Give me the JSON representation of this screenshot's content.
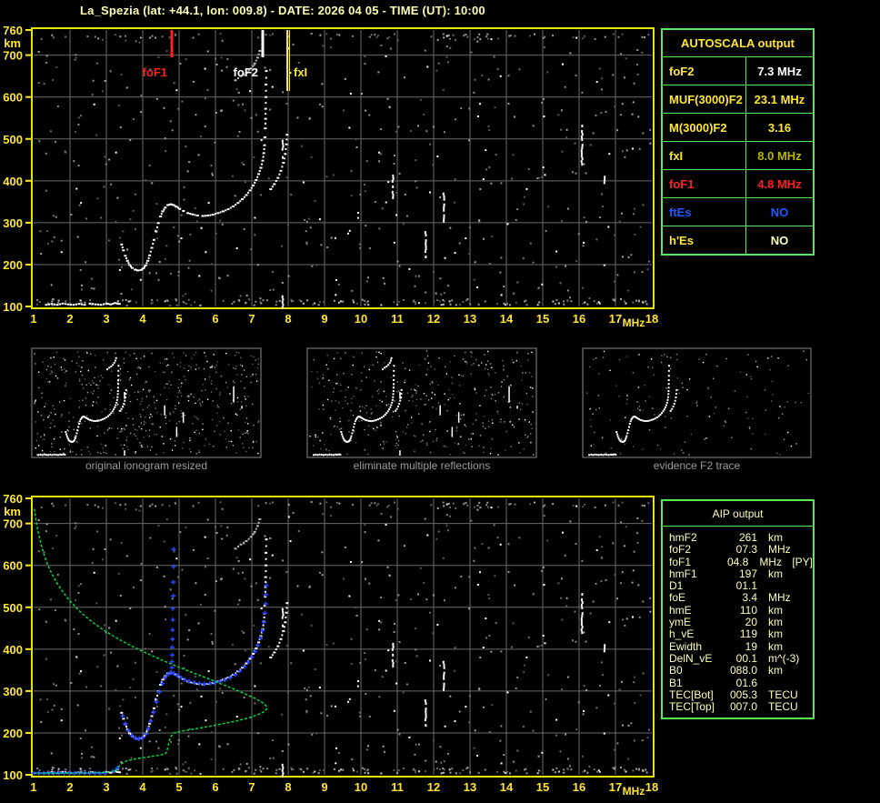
{
  "title": "La_Spezia (lat: +44.1, lon: 009.8) - DATE: 2026 04 05 - TIME (UT): 10:00",
  "colors": {
    "background": "#000000",
    "axis_label_yellow": "#ffe62e",
    "plot_border_yellow": "#e5e500",
    "grid_gray": "#6a6a6a",
    "table_border_green": "#58e858",
    "aip_text": "#ffffb8",
    "title_text": "#ffffb4",
    "caption_gray": "#9a9a9a",
    "profile_green": "#00d83c",
    "restored_blue": "#2945ff",
    "echo_white": "#ffffff",
    "marker_red": "#ff2020"
  },
  "autoscala_table": {
    "header": "AUTOSCALA output",
    "rows": [
      {
        "label": "foF2",
        "value": "7.3 MHz",
        "label_color": "#ffe62e",
        "value_color": "#ffffff"
      },
      {
        "label": "MUF(3000)F2",
        "value": "23.1 MHz",
        "label_color": "#ffe62e",
        "value_color": "#ffe62e"
      },
      {
        "label": "M(3000)F2",
        "value": "3.16",
        "label_color": "#ffe62e",
        "value_color": "#ffe62e"
      },
      {
        "label": "fxI",
        "value": "8.0 MHz",
        "label_color": "#ffe62e",
        "value_color": "#b9b500"
      },
      {
        "label": "foF1",
        "value": "4.8 MHz",
        "label_color": "#ff2020",
        "value_color": "#ff2020"
      },
      {
        "label": "ftEs",
        "value": "NO",
        "label_color": "#1e5aff",
        "value_color": "#1e5aff"
      },
      {
        "label": "h'Es",
        "value": "NO",
        "label_color": "#ffe62e",
        "value_color": "#ffffc8"
      }
    ]
  },
  "aip_table": {
    "header": "AIP output",
    "rows": [
      {
        "label": "hmF2",
        "value": "261",
        "unit": "km",
        "extra": ""
      },
      {
        "label": "foF2",
        "value": "07.3",
        "unit": "MHz",
        "extra": ""
      },
      {
        "label": "foF1",
        "value": "04.8",
        "unit": "MHz",
        "extra": "[PY]"
      },
      {
        "label": "hmF1",
        "value": "197",
        "unit": "km",
        "extra": ""
      },
      {
        "label": "D1",
        "value": "01.1",
        "unit": "",
        "extra": ""
      },
      {
        "label": "foE",
        "value": "3.4",
        "unit": "MHz",
        "extra": ""
      },
      {
        "label": "hmE",
        "value": "110",
        "unit": "km",
        "extra": ""
      },
      {
        "label": "ymE",
        "value": "20",
        "unit": "km",
        "extra": ""
      },
      {
        "label": "h_vE",
        "value": "119",
        "unit": "km",
        "extra": ""
      },
      {
        "label": "Ewidth",
        "value": "19",
        "unit": "km",
        "extra": ""
      },
      {
        "label": "DelN_vE",
        "value": "00.1",
        "unit": "m^(-3)",
        "extra": ""
      },
      {
        "label": "B0",
        "value": "088.0",
        "unit": "km",
        "extra": ""
      },
      {
        "label": "B1",
        "value": "01.6",
        "unit": "",
        "extra": ""
      },
      {
        "label": "TEC[Bot]",
        "value": "005.3",
        "unit": "TECU",
        "extra": ""
      },
      {
        "label": "TEC[Top]",
        "value": "007.0",
        "unit": "TECU",
        "extra": ""
      }
    ]
  },
  "thumbnails": [
    {
      "caption": "original ionogram resized",
      "noise_count": 520,
      "seed": 77,
      "show_streaks": true,
      "show_trace": true
    },
    {
      "caption": "eliminate multiple reflections",
      "noise_count": 400,
      "seed": 99,
      "show_streaks": true,
      "show_trace": true
    },
    {
      "caption": "evidence F2 trace",
      "noise_count": 150,
      "seed": 55,
      "show_streaks": false,
      "show_trace": true
    }
  ],
  "chart_data": {
    "type": "scatter",
    "charts": [
      {
        "id": "top-ionogram",
        "xlabel": "MHz",
        "ylabel": "km",
        "xlim": [
          1,
          18
        ],
        "ylim": [
          100,
          760
        ],
        "xticks": [
          1,
          2,
          3,
          4,
          5,
          6,
          7,
          8,
          9,
          10,
          11,
          12,
          13,
          14,
          15,
          16,
          17,
          18
        ],
        "yticks": [
          760,
          700,
          600,
          500,
          400,
          300,
          200,
          100
        ],
        "grid": true,
        "markers": [
          {
            "label": "foF1",
            "f": 4.8,
            "color": "#ff2020",
            "side": "left",
            "len": 30,
            "double": false
          },
          {
            "label": "foF2",
            "f": 7.3,
            "color": "#ffffff",
            "side": "left",
            "len": 30,
            "double": false
          },
          {
            "label": "fxI",
            "f": 8.0,
            "color": "#ffe62e",
            "side": "right",
            "len": 67,
            "double": true
          }
        ]
      },
      {
        "id": "bottom-ionogram",
        "xlabel": "MHz",
        "ylabel": "km",
        "xlim": [
          1,
          18
        ],
        "ylim": [
          100,
          760
        ],
        "xticks": [
          1,
          2,
          3,
          4,
          5,
          6,
          7,
          8,
          9,
          10,
          11,
          12,
          13,
          14,
          15,
          16,
          17,
          18
        ],
        "yticks": [
          760,
          700,
          600,
          500,
          400,
          300,
          200,
          100
        ],
        "grid": true,
        "markers": [],
        "profile": {
          "name": "electron-density-profile",
          "color": "#00d83c",
          "points": [
            [
              1.02,
              735
            ],
            [
              1.07,
              705
            ],
            [
              1.13,
              678
            ],
            [
              1.2,
              652
            ],
            [
              1.28,
              627
            ],
            [
              1.38,
              603
            ],
            [
              1.5,
              580
            ],
            [
              1.64,
              558
            ],
            [
              1.8,
              537
            ],
            [
              1.98,
              517
            ],
            [
              2.18,
              498
            ],
            [
              2.4,
              480
            ],
            [
              2.64,
              463
            ],
            [
              2.9,
              447
            ],
            [
              3.18,
              432
            ],
            [
              3.48,
              417
            ],
            [
              3.8,
              403
            ],
            [
              4.14,
              389
            ],
            [
              4.5,
              375
            ],
            [
              4.88,
              361
            ],
            [
              5.28,
              347
            ],
            [
              5.7,
              333
            ],
            [
              6.1,
              319
            ],
            [
              6.5,
              305
            ],
            [
              6.85,
              292
            ],
            [
              7.1,
              282
            ],
            [
              7.28,
              273
            ],
            [
              7.38,
              266
            ],
            [
              7.42,
              261
            ],
            [
              7.4,
              256
            ],
            [
              7.32,
              250
            ],
            [
              7.18,
              244
            ],
            [
              6.95,
              237
            ],
            [
              6.6,
              229
            ],
            [
              6.2,
              222
            ],
            [
              5.8,
              215
            ],
            [
              5.4,
              209
            ],
            [
              5.05,
              204
            ],
            [
              4.85,
              200
            ],
            [
              4.78,
              192
            ],
            [
              4.73,
              181
            ],
            [
              4.7,
              169
            ],
            [
              4.67,
              158
            ],
            [
              4.62,
              150
            ],
            [
              4.4,
              146
            ],
            [
              4.1,
              142
            ],
            [
              3.8,
              138
            ],
            [
              3.55,
              133
            ],
            [
              3.42,
              127
            ],
            [
              3.34,
              120
            ],
            [
              3.3,
              114
            ],
            [
              3.22,
              109
            ],
            [
              3.05,
              106
            ],
            [
              2.7,
              105
            ],
            [
              2.2,
              104
            ],
            [
              1.6,
              104
            ],
            [
              1.02,
              104
            ]
          ]
        },
        "restored_trace": {
          "name": "restored-trace",
          "color": "#2945ff",
          "flat_segment": {
            "f0": 1.0,
            "f1": 2.98,
            "km": 104
          },
          "points": [
            [
              3.18,
              108
            ],
            [
              3.3,
              116
            ],
            [
              3.45,
              240
            ],
            [
              3.52,
              222
            ],
            [
              3.6,
              206
            ],
            [
              3.7,
              194
            ],
            [
              3.8,
              188
            ],
            [
              3.9,
              186
            ],
            [
              4.0,
              189
            ],
            [
              4.08,
              197
            ],
            [
              4.15,
              210
            ],
            [
              4.22,
              228
            ],
            [
              4.3,
              250
            ],
            [
              4.38,
              274
            ],
            [
              4.46,
              298
            ],
            [
              4.54,
              318
            ],
            [
              4.62,
              332
            ],
            [
              4.7,
              340
            ],
            [
              4.78,
              344
            ],
            [
              4.86,
              342
            ],
            [
              4.95,
              337
            ],
            [
              5.05,
              332
            ],
            [
              5.16,
              327
            ],
            [
              5.28,
              323
            ],
            [
              5.42,
              320
            ],
            [
              5.56,
              318
            ],
            [
              5.7,
              317
            ],
            [
              5.84,
              318
            ],
            [
              5.98,
              320
            ],
            [
              6.12,
              323
            ],
            [
              6.26,
              327
            ],
            [
              6.4,
              332
            ],
            [
              6.54,
              339
            ],
            [
              6.67,
              348
            ],
            [
              6.79,
              358
            ],
            [
              6.9,
              369
            ],
            [
              7.0,
              381
            ],
            [
              7.09,
              394
            ],
            [
              7.17,
              409
            ],
            [
              7.24,
              426
            ],
            [
              7.29,
              444
            ],
            [
              7.33,
              464
            ],
            [
              7.36,
              486
            ],
            [
              7.38,
              508
            ]
          ],
          "f1_asymptote": [
            [
              4.8,
              356
            ],
            [
              4.8,
              370
            ],
            [
              4.81,
              386
            ],
            [
              4.81,
              404
            ],
            [
              4.82,
              424
            ],
            [
              4.82,
              446
            ],
            [
              4.83,
              470
            ],
            [
              4.83,
              497
            ],
            [
              4.84,
              527
            ],
            [
              4.84,
              560
            ],
            [
              4.85,
              597
            ],
            [
              4.85,
              638
            ]
          ],
          "f2_asymptote": [
            [
              7.39,
              530
            ],
            [
              7.4,
              552
            ]
          ]
        }
      }
    ],
    "shared_echo_series": [
      {
        "name": "F-trace-o-mode",
        "color": "#ffffff",
        "points": [
          [
            3.42,
            248
          ],
          [
            3.47,
            234
          ],
          [
            3.52,
            221
          ],
          [
            3.58,
            209
          ],
          [
            3.64,
            199
          ],
          [
            3.71,
            192
          ],
          [
            3.79,
            188
          ],
          [
            3.87,
            186
          ],
          [
            3.95,
            187
          ],
          [
            4.02,
            191
          ],
          [
            4.08,
            198
          ],
          [
            4.14,
            209
          ],
          [
            4.19,
            222
          ],
          [
            4.25,
            240
          ],
          [
            4.31,
            259
          ],
          [
            4.37,
            279
          ],
          [
            4.43,
            299
          ],
          [
            4.49,
            315
          ],
          [
            4.55,
            327
          ],
          [
            4.62,
            336
          ],
          [
            4.69,
            342
          ],
          [
            4.77,
            344
          ],
          [
            4.85,
            342
          ],
          [
            4.93,
            338
          ],
          [
            5.02,
            333
          ],
          [
            5.12,
            328
          ],
          [
            5.24,
            323
          ],
          [
            5.37,
            320
          ],
          [
            5.51,
            317
          ],
          [
            5.65,
            316
          ],
          [
            5.79,
            317
          ],
          [
            5.93,
            319
          ],
          [
            6.07,
            323
          ],
          [
            6.21,
            327
          ],
          [
            6.35,
            332
          ],
          [
            6.49,
            339
          ],
          [
            6.62,
            347
          ],
          [
            6.74,
            356
          ],
          [
            6.85,
            366
          ],
          [
            6.95,
            377
          ],
          [
            7.04,
            389
          ],
          [
            7.12,
            402
          ],
          [
            7.19,
            416
          ],
          [
            7.25,
            431
          ],
          [
            7.3,
            448
          ],
          [
            7.33,
            466
          ],
          [
            7.35,
            485
          ],
          [
            7.36,
            504
          ]
        ]
      },
      {
        "name": "F2-o-asymptote-dots",
        "color": "#ffffff",
        "points": [
          [
            7.37,
            525
          ],
          [
            7.38,
            548
          ],
          [
            7.38,
            572
          ],
          [
            7.39,
            600
          ],
          [
            7.39,
            630
          ],
          [
            7.4,
            662
          ]
        ]
      },
      {
        "name": "x-mode-branch",
        "color": "#ffffff",
        "points": [
          [
            7.52,
            380
          ],
          [
            7.62,
            392
          ],
          [
            7.72,
            407
          ],
          [
            7.8,
            424
          ],
          [
            7.87,
            443
          ],
          [
            7.92,
            464
          ],
          [
            7.95,
            487
          ],
          [
            7.97,
            510
          ]
        ]
      },
      {
        "name": "E-trace",
        "color": "#ffffff",
        "points": [
          [
            1.35,
            104
          ],
          [
            1.5,
            106
          ],
          [
            1.65,
            104
          ],
          [
            1.8,
            107
          ],
          [
            1.95,
            105
          ],
          [
            2.1,
            104
          ],
          [
            2.25,
            106
          ],
          [
            2.4,
            104
          ],
          [
            2.55,
            107
          ],
          [
            2.7,
            105
          ],
          [
            2.85,
            104
          ],
          [
            3.0,
            107
          ],
          [
            3.12,
            105
          ],
          [
            3.24,
            108
          ],
          [
            3.36,
            106
          ]
        ]
      },
      {
        "name": "second-hop-echo",
        "color": "#b5b5b5",
        "points": [
          [
            6.55,
            640
          ],
          [
            6.7,
            650
          ],
          [
            6.85,
            658
          ],
          [
            6.98,
            668
          ],
          [
            7.08,
            680
          ],
          [
            7.16,
            694
          ],
          [
            7.22,
            710
          ]
        ]
      }
    ],
    "vertical_echo_streaks": [
      [
        10.88,
        352,
        415
      ],
      [
        11.78,
        216,
        280
      ],
      [
        12.28,
        306,
        372
      ],
      [
        16.08,
        432,
        534
      ],
      [
        16.7,
        394,
        412
      ],
      [
        7.85,
        100,
        133
      ],
      [
        7.85,
        455,
        498
      ]
    ],
    "noise": {
      "seed": 12345,
      "count": 560,
      "white_ratio": 0.12,
      "edge_bottom": 150,
      "edge_top": 60
    }
  }
}
